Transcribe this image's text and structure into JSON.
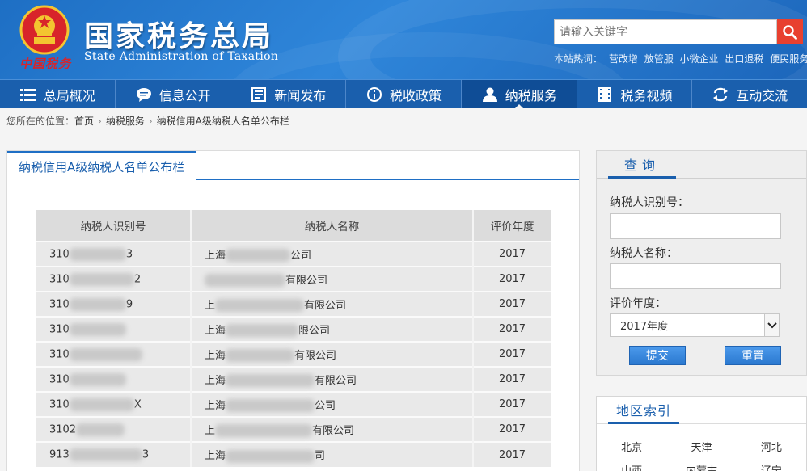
{
  "header": {
    "brand_script": "中国税务",
    "title": "国家税务总局",
    "subtitle": "State Administration of Taxation",
    "search_placeholder": "请输入关键字",
    "hotwords_label": "本站热词：",
    "hotwords": [
      "营改增",
      "放管服",
      "小微企业",
      "出口退税",
      "便民服务"
    ]
  },
  "nav": {
    "items": [
      {
        "label": "总局概况",
        "icon": "list-icon"
      },
      {
        "label": "信息公开",
        "icon": "speech-bubble-icon"
      },
      {
        "label": "新闻发布",
        "icon": "document-icon"
      },
      {
        "label": "税收政策",
        "icon": "info-icon"
      },
      {
        "label": "纳税服务",
        "icon": "person-icon",
        "active": true
      },
      {
        "label": "税务视频",
        "icon": "film-icon"
      },
      {
        "label": "互动交流",
        "icon": "exchange-icon"
      }
    ]
  },
  "breadcrumb": {
    "prefix": "您所在的位置：",
    "items": [
      "首页",
      "纳税服务",
      "纳税信用A级纳税人名单公布栏"
    ]
  },
  "main": {
    "tab_label": "纳税信用A级纳税人名单公布栏",
    "table": {
      "headers": [
        "纳税人识别号",
        "纳税人名称",
        "评价年度"
      ],
      "rows": [
        {
          "id_prefix": "310",
          "id_suffix": "3",
          "name_prefix": "上海",
          "name_suffix": "公司",
          "year": "2017"
        },
        {
          "id_prefix": "310",
          "id_suffix": "2",
          "name_prefix": "",
          "name_suffix": "有限公司",
          "year": "2017"
        },
        {
          "id_prefix": "310",
          "id_suffix": "9",
          "name_prefix": "上",
          "name_suffix": "有限公司",
          "year": "2017"
        },
        {
          "id_prefix": "310",
          "id_suffix": "",
          "name_prefix": "上海",
          "name_suffix": "限公司",
          "year": "2017"
        },
        {
          "id_prefix": "310",
          "id_suffix": "",
          "name_prefix": "上海",
          "name_suffix": "有限公司",
          "year": "2017"
        },
        {
          "id_prefix": "310",
          "id_suffix": "",
          "name_prefix": "上海",
          "name_suffix": "有限公司",
          "year": "2017"
        },
        {
          "id_prefix": "310",
          "id_suffix": "X",
          "name_prefix": "上海",
          "name_suffix": "公司",
          "year": "2017"
        },
        {
          "id_prefix": "3102",
          "id_suffix": "",
          "name_prefix": "上",
          "name_suffix": "有限公司",
          "year": "2017"
        },
        {
          "id_prefix": "913",
          "id_suffix": "3",
          "name_prefix": "上海",
          "name_suffix": "司",
          "year": "2017"
        }
      ]
    }
  },
  "query": {
    "title": "查询",
    "id_label": "纳税人识别号：",
    "name_label": "纳税人名称：",
    "year_label": "评价年度：",
    "year_value": "2017年度",
    "submit_label": "提交",
    "reset_label": "重置"
  },
  "region": {
    "title": "地区索引",
    "items": [
      "北京",
      "天津",
      "河北",
      "山西",
      "内蒙古",
      "辽宁"
    ]
  },
  "colors": {
    "header_blue": "#1e6fc4",
    "nav_blue": "#1a5fad",
    "search_red": "#e8402f",
    "brand_red": "#d8242a"
  }
}
